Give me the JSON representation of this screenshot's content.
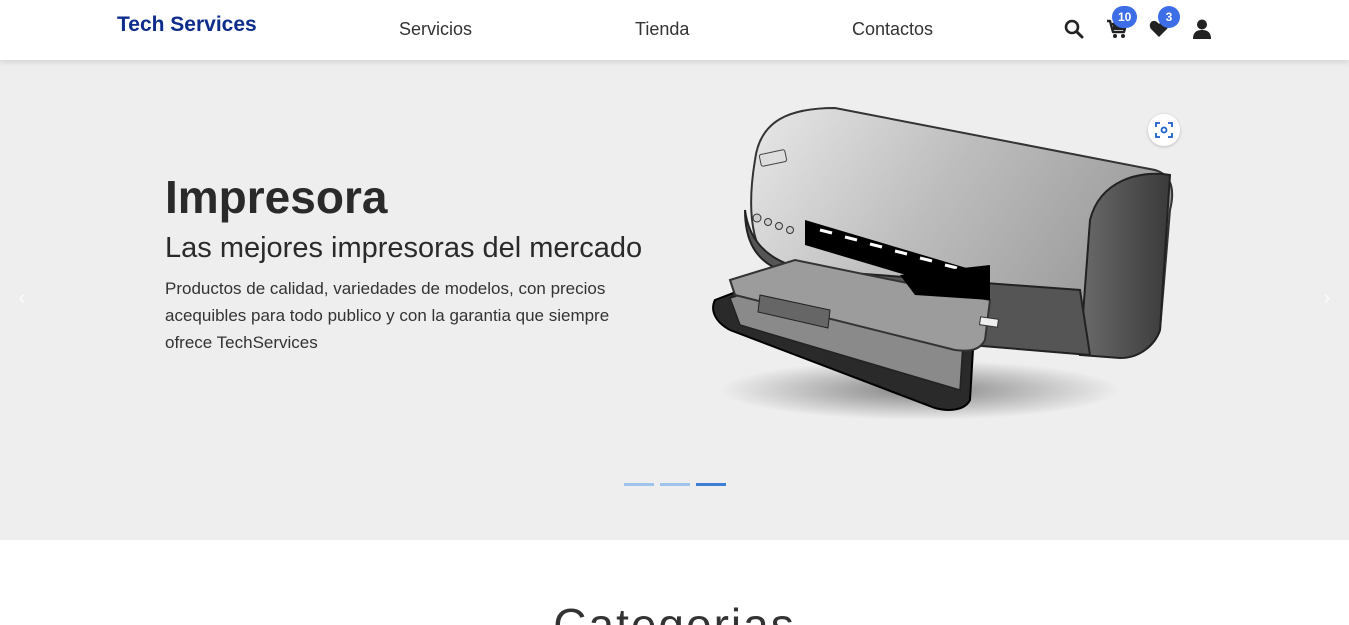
{
  "navbar": {
    "brand": "Tech Services",
    "links": [
      "Servicios",
      "Tienda",
      "Contactos"
    ],
    "cart_count": "10",
    "wishlist_count": "3",
    "icons": [
      "search-icon",
      "cart-icon",
      "heart-icon",
      "user-icon"
    ]
  },
  "hero": {
    "title": "Impresora",
    "subtitle": "Las mejores impresoras del mercado",
    "text": "Productos de calidad, variedades de modelos, con precios acequibles para todo publico y con la garantia que siempre ofrece TechServices",
    "slides_total": 3,
    "active_slide": 3
  },
  "categories": {
    "title": "Categorias"
  },
  "colors": {
    "brand": "#0d2c8c",
    "badge": "#3d6ee8",
    "hero_bg": "#eeeeee"
  }
}
